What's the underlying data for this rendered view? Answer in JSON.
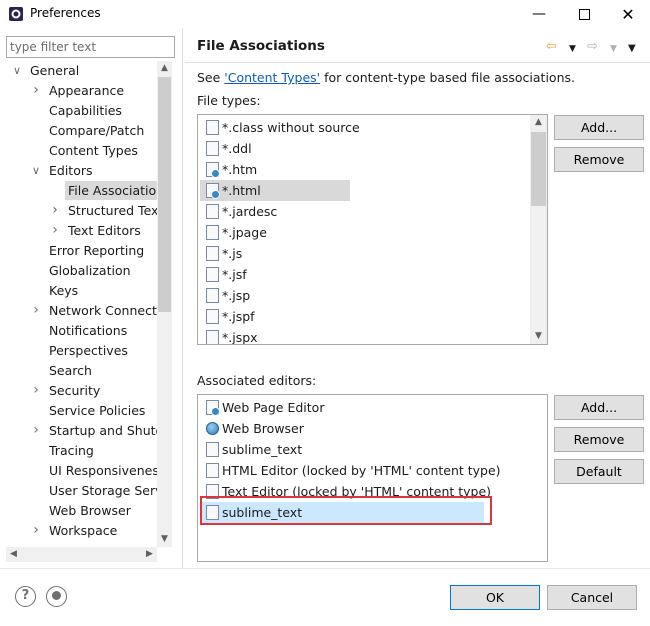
{
  "window": {
    "title": "Preferences",
    "minimize_icon": "minimize-icon",
    "maximize_icon": "maximize-icon",
    "close_icon": "close-icon"
  },
  "filter": {
    "placeholder": "type filter text"
  },
  "tree": {
    "items": [
      {
        "label": "General",
        "twisty": "expanded"
      },
      {
        "label": "Appearance",
        "twisty": "collapsed"
      },
      {
        "label": "Capabilities",
        "twisty": ""
      },
      {
        "label": "Compare/Patch",
        "twisty": ""
      },
      {
        "label": "Content Types",
        "twisty": ""
      },
      {
        "label": "Editors",
        "twisty": "expanded"
      },
      {
        "label": "File Associations",
        "twisty": "",
        "selected": true
      },
      {
        "label": "Structured Text",
        "twisty": "collapsed"
      },
      {
        "label": "Text Editors",
        "twisty": "collapsed"
      },
      {
        "label": "Error Reporting",
        "twisty": ""
      },
      {
        "label": "Globalization",
        "twisty": ""
      },
      {
        "label": "Keys",
        "twisty": ""
      },
      {
        "label": "Network Connections",
        "twisty": "collapsed"
      },
      {
        "label": "Notifications",
        "twisty": ""
      },
      {
        "label": "Perspectives",
        "twisty": ""
      },
      {
        "label": "Search",
        "twisty": ""
      },
      {
        "label": "Security",
        "twisty": "collapsed"
      },
      {
        "label": "Service Policies",
        "twisty": ""
      },
      {
        "label": "Startup and Shutdown",
        "twisty": "collapsed"
      },
      {
        "label": "Tracing",
        "twisty": ""
      },
      {
        "label": "UI Responsiveness",
        "twisty": ""
      },
      {
        "label": "User Storage Service",
        "twisty": ""
      },
      {
        "label": "Web Browser",
        "twisty": ""
      },
      {
        "label": "Workspace",
        "twisty": "collapsed"
      }
    ]
  },
  "page": {
    "title": "File Associations",
    "see_prefix": "See ",
    "see_link": "'Content Types'",
    "see_suffix": " for content-type based file associations.",
    "file_types_label": "File types:",
    "file_types": [
      {
        "label": "*.class without source",
        "icon": "binary-file-icon"
      },
      {
        "label": "*.ddl",
        "icon": "ddl-file-icon"
      },
      {
        "label": "*.htm",
        "icon": "web-file-icon"
      },
      {
        "label": "*.html",
        "icon": "web-file-icon",
        "selected": true
      },
      {
        "label": "*.jardesc",
        "icon": "jar-file-icon"
      },
      {
        "label": "*.jpage",
        "icon": "java-file-icon"
      },
      {
        "label": "*.js",
        "icon": "js-file-icon"
      },
      {
        "label": "*.jsf",
        "icon": "text-file-icon"
      },
      {
        "label": "*.jsp",
        "icon": "text-file-icon"
      },
      {
        "label": "*.jspf",
        "icon": "text-file-icon"
      },
      {
        "label": "*.jspx",
        "icon": "text-file-icon"
      }
    ],
    "add_label": "Add...",
    "remove_label": "Remove",
    "associated_label": "Associated editors:",
    "editors": [
      {
        "label": "Web Page Editor",
        "icon": "web-page-icon"
      },
      {
        "label": "Web Browser",
        "icon": "globe-icon"
      },
      {
        "label": "sublime_text",
        "icon": "text-file-icon"
      },
      {
        "label": "HTML Editor (locked by 'HTML' content type)",
        "icon": "text-file-icon"
      },
      {
        "label": "Text Editor (locked by 'HTML' content type)",
        "icon": "text-file-icon"
      },
      {
        "label": "sublime_text",
        "icon": "text-file-icon",
        "selected": true
      }
    ],
    "add2_label": "Add...",
    "remove2_label": "Remove",
    "default_label": "Default"
  },
  "footer": {
    "help_icon": "help-icon",
    "import_export_icon": "record-icon",
    "ok_label": "OK",
    "cancel_label": "Cancel"
  },
  "colors": {
    "selection_blue": "#cce8ff",
    "selection_gray": "#d9d9d9",
    "highlight_red": "#d9363e",
    "link": "#0a5cc2"
  }
}
